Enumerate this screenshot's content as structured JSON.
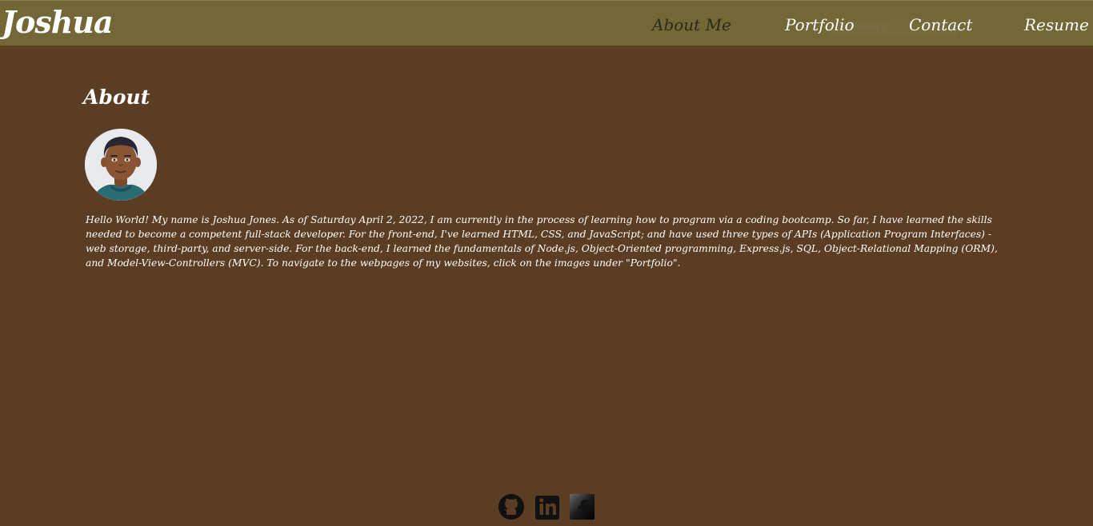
{
  "header": {
    "brand": "Joshua",
    "nav": [
      {
        "label": "About Me",
        "active": true
      },
      {
        "label": "Portfolio",
        "active": false
      },
      {
        "label": "Contact",
        "active": false
      },
      {
        "label": "Resume",
        "active": false
      }
    ],
    "ghost_label": "rectangular S"
  },
  "about": {
    "title": "About",
    "avatar_icon": "person-avatar-icon",
    "bio": "Hello World! My name is Joshua Jones. As of Saturday April 2, 2022, I am currently in the process of learning how to program via a coding bootcamp. So far, I have learned the skills needed to become a competent full-stack developer. For the front-end, I've learned HTML, CSS, and JavaScript; and have used three types of APIs (Application Program Interfaces) - web storage, third-party, and server-side. For the back-end, I learned the fundamentals of Node.js, Object-Oriented programming, Express.js, SQL, Object-Relational Mapping (ORM), and Model-View-Controllers (MVC). To navigate to the webpages of my websites, click on the images under \"Portfolio\"."
  },
  "footer": {
    "socials": [
      {
        "name": "github-icon"
      },
      {
        "name": "linkedin-icon"
      },
      {
        "name": "facebook-icon"
      }
    ]
  },
  "colors": {
    "page_bg": "#5a3d22",
    "header_bg": "#736637",
    "text": "#ffffff",
    "active_nav": "#2c2a1a"
  }
}
